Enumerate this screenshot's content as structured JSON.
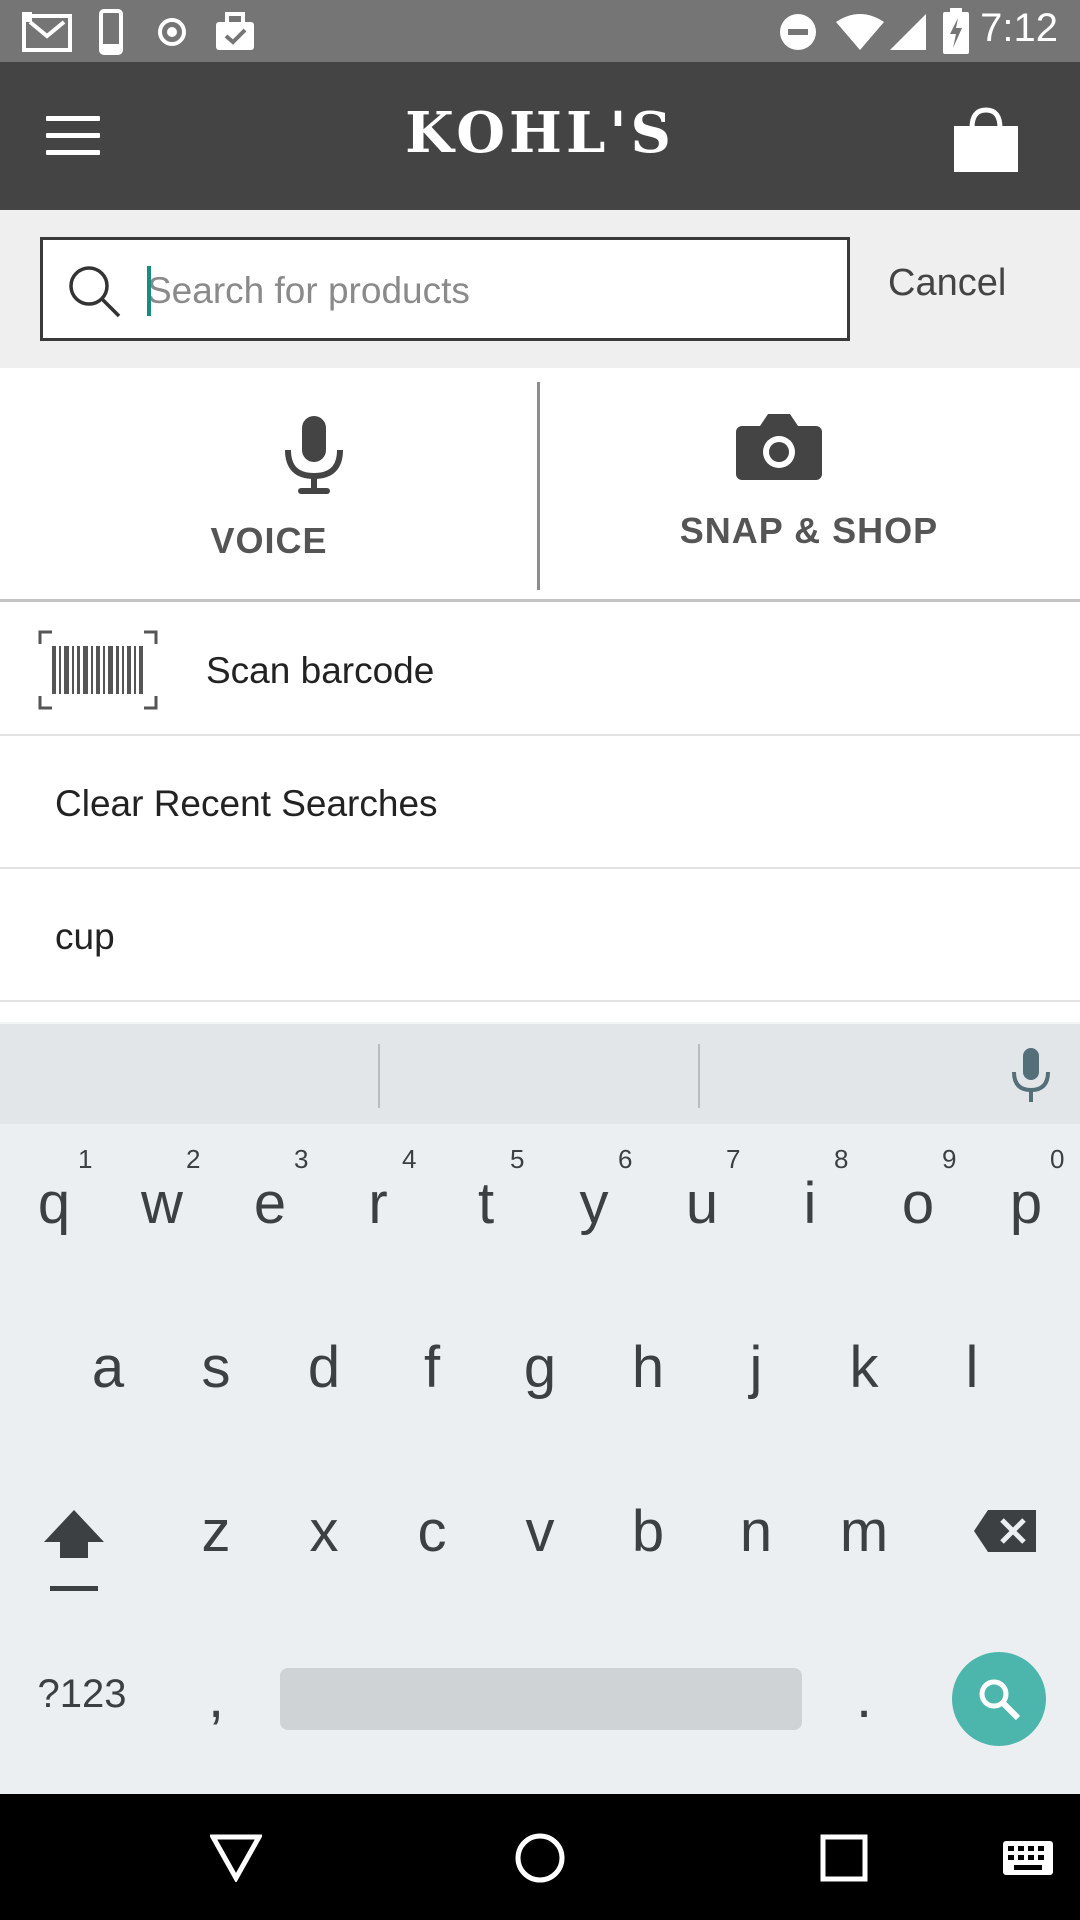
{
  "status_bar": {
    "time": "7:12",
    "icons": [
      "gmail-icon",
      "phone-icon",
      "record-icon",
      "briefcase-check-icon",
      "do-not-disturb-icon",
      "wifi-icon",
      "signal-icon",
      "battery-charging-icon"
    ]
  },
  "app_bar": {
    "logo": "KOHL'S",
    "menu_icon": "hamburger-menu-icon",
    "cart_icon": "shopping-bag-icon"
  },
  "search": {
    "placeholder": "Search for products",
    "value": "",
    "cancel_label": "Cancel"
  },
  "options": {
    "voice_label": "VOICE",
    "snap_label": "SNAP & SHOP"
  },
  "list": {
    "scan_barcode": "Scan barcode",
    "clear_recent": "Clear Recent Searches",
    "recent_searches": [
      "cup"
    ]
  },
  "keyboard": {
    "row1": [
      "q",
      "w",
      "e",
      "r",
      "t",
      "y",
      "u",
      "i",
      "o",
      "p"
    ],
    "row1_hints": [
      "1",
      "2",
      "3",
      "4",
      "5",
      "6",
      "7",
      "8",
      "9",
      "0"
    ],
    "row2": [
      "a",
      "s",
      "d",
      "f",
      "g",
      "h",
      "j",
      "k",
      "l"
    ],
    "row3": [
      "z",
      "x",
      "c",
      "v",
      "b",
      "n",
      "m"
    ],
    "symbols_key": "?123",
    "comma_key": ",",
    "period_key": "."
  },
  "colors": {
    "app_bar": "#444444",
    "status_bar": "#757575",
    "search_key": "#4db6ac",
    "cursor": "#1a8c7e"
  }
}
